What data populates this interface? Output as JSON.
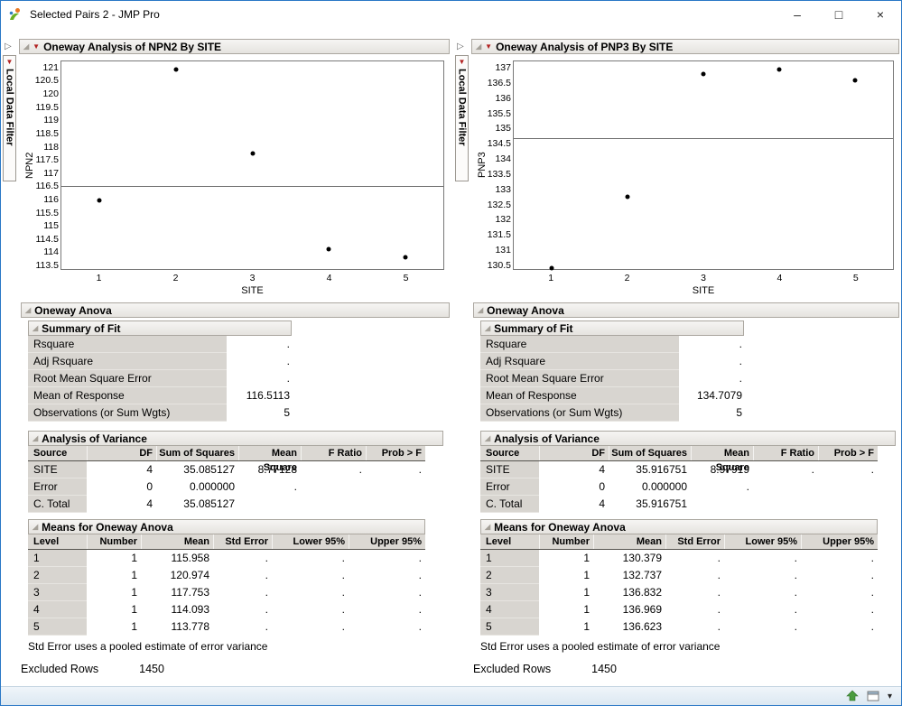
{
  "window": {
    "title": "Selected Pairs 2 - JMP Pro"
  },
  "icons": {
    "red_triangle": "▼",
    "disclosure": "◢",
    "collapse_arrow": "▷",
    "dropdown_arrow": "▾",
    "minimize": "–",
    "maximize": "□",
    "close": "×"
  },
  "filter": {
    "label": "Local Data Filter"
  },
  "panels": [
    {
      "title": "Oneway Analysis of NPN2 By SITE",
      "anova_outline": "Oneway Anova",
      "chart_data": {
        "type": "scatter",
        "x": [
          1,
          2,
          3,
          4,
          5
        ],
        "y": [
          115.958,
          120.974,
          117.753,
          114.093,
          113.778
        ],
        "mean_line": 116.5113,
        "xlabel": "SITE",
        "ylabel": "NPN2",
        "ylim": [
          113.33,
          121.27
        ],
        "yticks": [
          121,
          120.5,
          120,
          119.5,
          119,
          118.5,
          118,
          117.5,
          117,
          116.5,
          116,
          115.5,
          115,
          114.5,
          114,
          113.5
        ],
        "xticks": [
          1,
          2,
          3,
          4,
          5
        ],
        "grid": false
      },
      "summary_of_fit": {
        "title": "Summary of Fit",
        "rows": [
          [
            "Rsquare",
            "."
          ],
          [
            "Adj Rsquare",
            "."
          ],
          [
            "Root Mean Square Error",
            "."
          ],
          [
            "Mean of Response",
            "116.5113"
          ],
          [
            "Observations (or Sum Wgts)",
            "5"
          ]
        ]
      },
      "analysis_of_variance": {
        "title": "Analysis of Variance",
        "columns": [
          "Source",
          "DF",
          "Sum of Squares",
          "Mean Square",
          "F Ratio",
          "Prob > F"
        ],
        "rows": [
          [
            "SITE",
            "4",
            "35.085127",
            "8.77128",
            ".",
            "."
          ],
          [
            "Error",
            "0",
            "0.000000",
            ".",
            "",
            ""
          ],
          [
            "C. Total",
            "4",
            "35.085127",
            "",
            "",
            ""
          ]
        ]
      },
      "means": {
        "title": "Means for Oneway Anova",
        "columns": [
          "Level",
          "Number",
          "Mean",
          "Std Error",
          "Lower 95%",
          "Upper 95%"
        ],
        "rows": [
          [
            "1",
            "1",
            "115.958",
            ".",
            ".",
            "."
          ],
          [
            "2",
            "1",
            "120.974",
            ".",
            ".",
            "."
          ],
          [
            "3",
            "1",
            "117.753",
            ".",
            ".",
            "."
          ],
          [
            "4",
            "1",
            "114.093",
            ".",
            ".",
            "."
          ],
          [
            "5",
            "1",
            "113.778",
            ".",
            ".",
            "."
          ]
        ]
      },
      "footnote": "Std Error uses a pooled estimate of error variance",
      "excluded_rows": {
        "label": "Excluded Rows",
        "value": "1450"
      }
    },
    {
      "title": "Oneway Analysis of PNP3 By SITE",
      "anova_outline": "Oneway Anova",
      "chart_data": {
        "type": "scatter",
        "x": [
          1,
          2,
          3,
          4,
          5
        ],
        "y": [
          130.379,
          132.737,
          136.832,
          136.969,
          136.623
        ],
        "mean_line": 134.7079,
        "xlabel": "SITE",
        "ylabel": "PNP3",
        "ylim": [
          130.35,
          137.24
        ],
        "yticks": [
          137,
          136.5,
          136,
          135.5,
          135,
          134.5,
          134,
          133.5,
          133,
          132.5,
          132,
          131.5,
          131,
          130.5
        ],
        "xticks": [
          1,
          2,
          3,
          4,
          5
        ],
        "grid": false
      },
      "summary_of_fit": {
        "title": "Summary of Fit",
        "rows": [
          [
            "Rsquare",
            "."
          ],
          [
            "Adj Rsquare",
            "."
          ],
          [
            "Root Mean Square Error",
            "."
          ],
          [
            "Mean of Response",
            "134.7079"
          ],
          [
            "Observations (or Sum Wgts)",
            "5"
          ]
        ]
      },
      "analysis_of_variance": {
        "title": "Analysis of Variance",
        "columns": [
          "Source",
          "DF",
          "Sum of Squares",
          "Mean Square",
          "F Ratio",
          "Prob > F"
        ],
        "rows": [
          [
            "SITE",
            "4",
            "35.916751",
            "8.97919",
            ".",
            "."
          ],
          [
            "Error",
            "0",
            "0.000000",
            ".",
            "",
            ""
          ],
          [
            "C. Total",
            "4",
            "35.916751",
            "",
            "",
            ""
          ]
        ]
      },
      "means": {
        "title": "Means for Oneway Anova",
        "columns": [
          "Level",
          "Number",
          "Mean",
          "Std Error",
          "Lower 95%",
          "Upper 95%"
        ],
        "rows": [
          [
            "1",
            "1",
            "130.379",
            ".",
            ".",
            "."
          ],
          [
            "2",
            "1",
            "132.737",
            ".",
            ".",
            "."
          ],
          [
            "3",
            "1",
            "136.832",
            ".",
            ".",
            "."
          ],
          [
            "4",
            "1",
            "136.969",
            ".",
            ".",
            "."
          ],
          [
            "5",
            "1",
            "136.623",
            ".",
            ".",
            "."
          ]
        ]
      },
      "footnote": "Std Error uses a pooled estimate of error variance",
      "excluded_rows": {
        "label": "Excluded Rows",
        "value": "1450"
      }
    }
  ]
}
